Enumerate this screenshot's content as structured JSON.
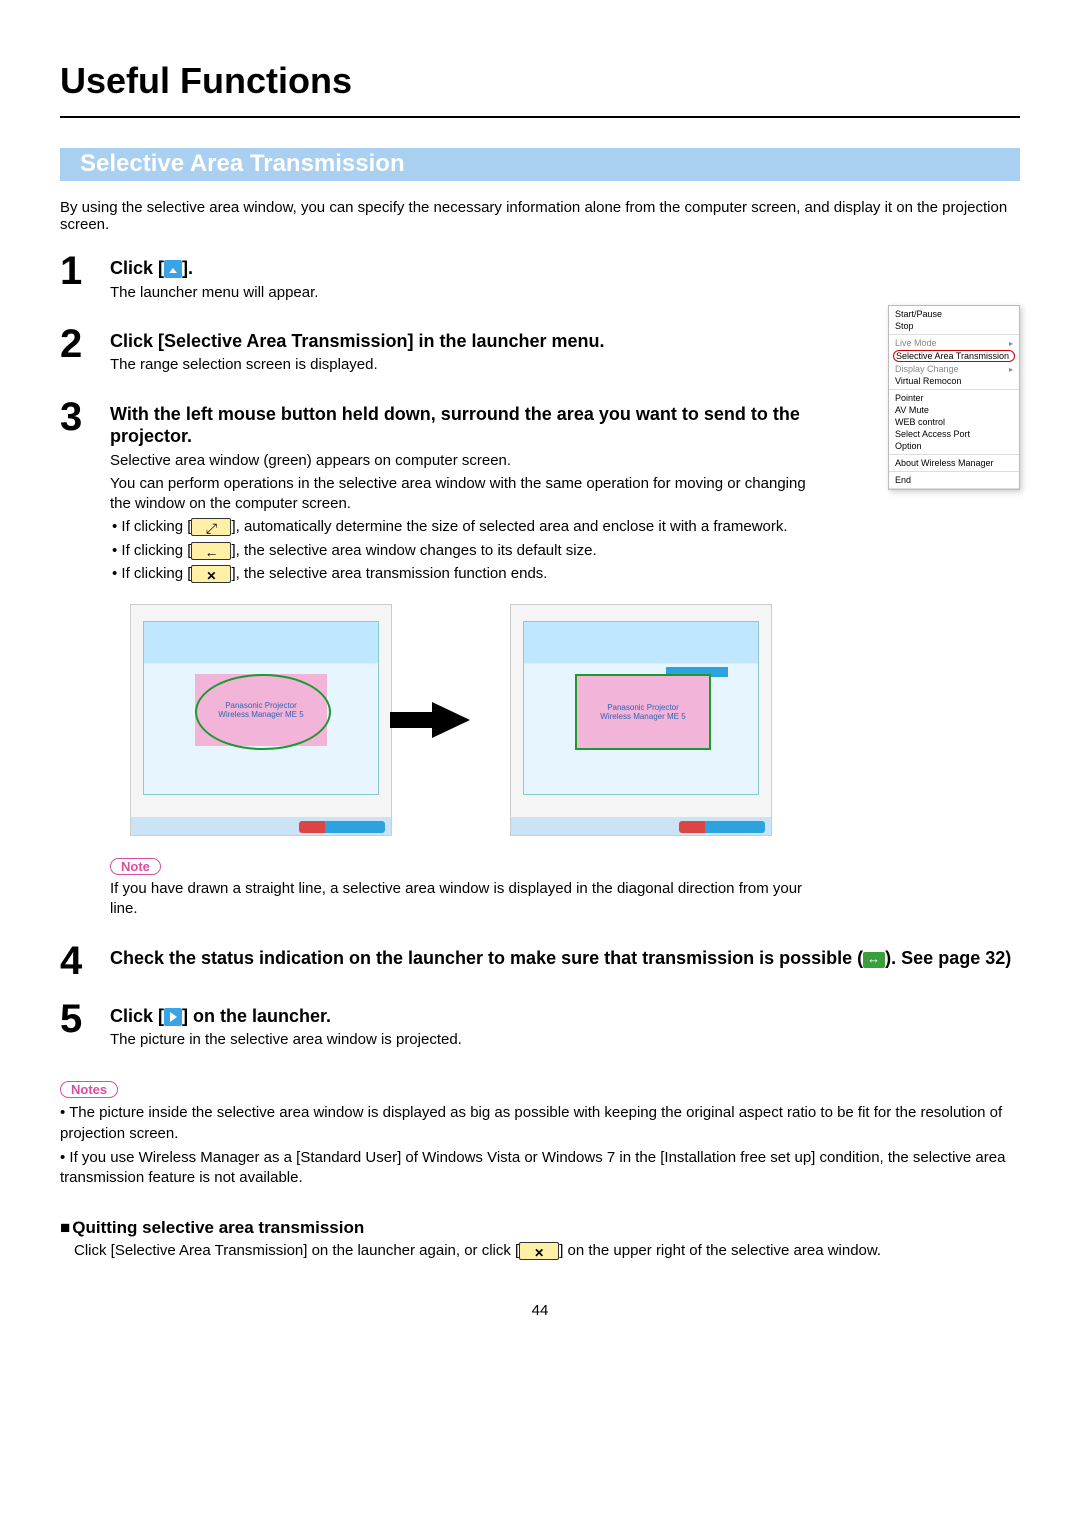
{
  "title": "Useful Functions",
  "section": "Selective Area Transmission",
  "intro": "By using the selective area window, you can specify the necessary information alone from the computer screen, and display it on the projection screen.",
  "steps": {
    "s1_title_a": "Click [",
    "s1_title_b": "].",
    "s1_desc": "The launcher menu will appear.",
    "s2_title": "Click [Selective Area Transmission] in the launcher menu.",
    "s2_desc": "The range selection screen is displayed.",
    "s3_title": "With the left mouse button held down, surround the area you want to send to the projector.",
    "s3_desc1": "Selective area window (green) appears on computer screen.",
    "s3_desc2": "You can perform operations in the selective area window with the same operation for moving or changing the window on the computer screen.",
    "s3_b1a": "• If clicking [",
    "s3_b1b": "], automatically determine the size of selected area and enclose it with a framework.",
    "s3_b2a": "• If clicking [",
    "s3_b2b": "], the selective area window changes to its default size.",
    "s3_b3a": "• If clicking [",
    "s3_b3b": "], the selective area transmission function ends.",
    "s3_note": "If you have drawn a straight line, a selective area window is displayed in the diagonal direction from your line.",
    "s4_title_a": "Check the status indication on the launcher to make sure that transmission is possible (",
    "s4_title_b": "). See page 32)",
    "s5_title_a": "Click [",
    "s5_title_b": "] on the launcher.",
    "s5_desc": "The picture in the selective area window is projected."
  },
  "fig": {
    "line1": "Panasonic Projector",
    "line2": "Wireless Manager ME 5"
  },
  "notes_label": "Notes",
  "note1": "• The picture inside the selective area window is displayed as big as possible with keeping the original aspect ratio to be fit for the resolution of projection screen.",
  "note2": "• If you use Wireless Manager as a [Standard User] of Windows Vista or Windows 7 in the [Installation free set up] condition, the selective area transmission feature is not available.",
  "notepill": "Note",
  "quit_heading": "Quitting selective area transmission",
  "quit_text_a": "Click [Selective Area Transmission] on the launcher again, or click [",
  "quit_text_b": "] on the upper right of the selective area window.",
  "page_num": "44",
  "menu": {
    "start": "Start/Pause",
    "stop": "Stop",
    "live": "Live Mode",
    "sat": "Selective Area Transmission",
    "dc": "Display Change",
    "vr": "Virtual Remocon",
    "pointer": "Pointer",
    "avmute": "AV Mute",
    "web": "WEB control",
    "sap": "Select Access Port",
    "option": "Option",
    "about": "About Wireless Manager",
    "end": "End"
  }
}
